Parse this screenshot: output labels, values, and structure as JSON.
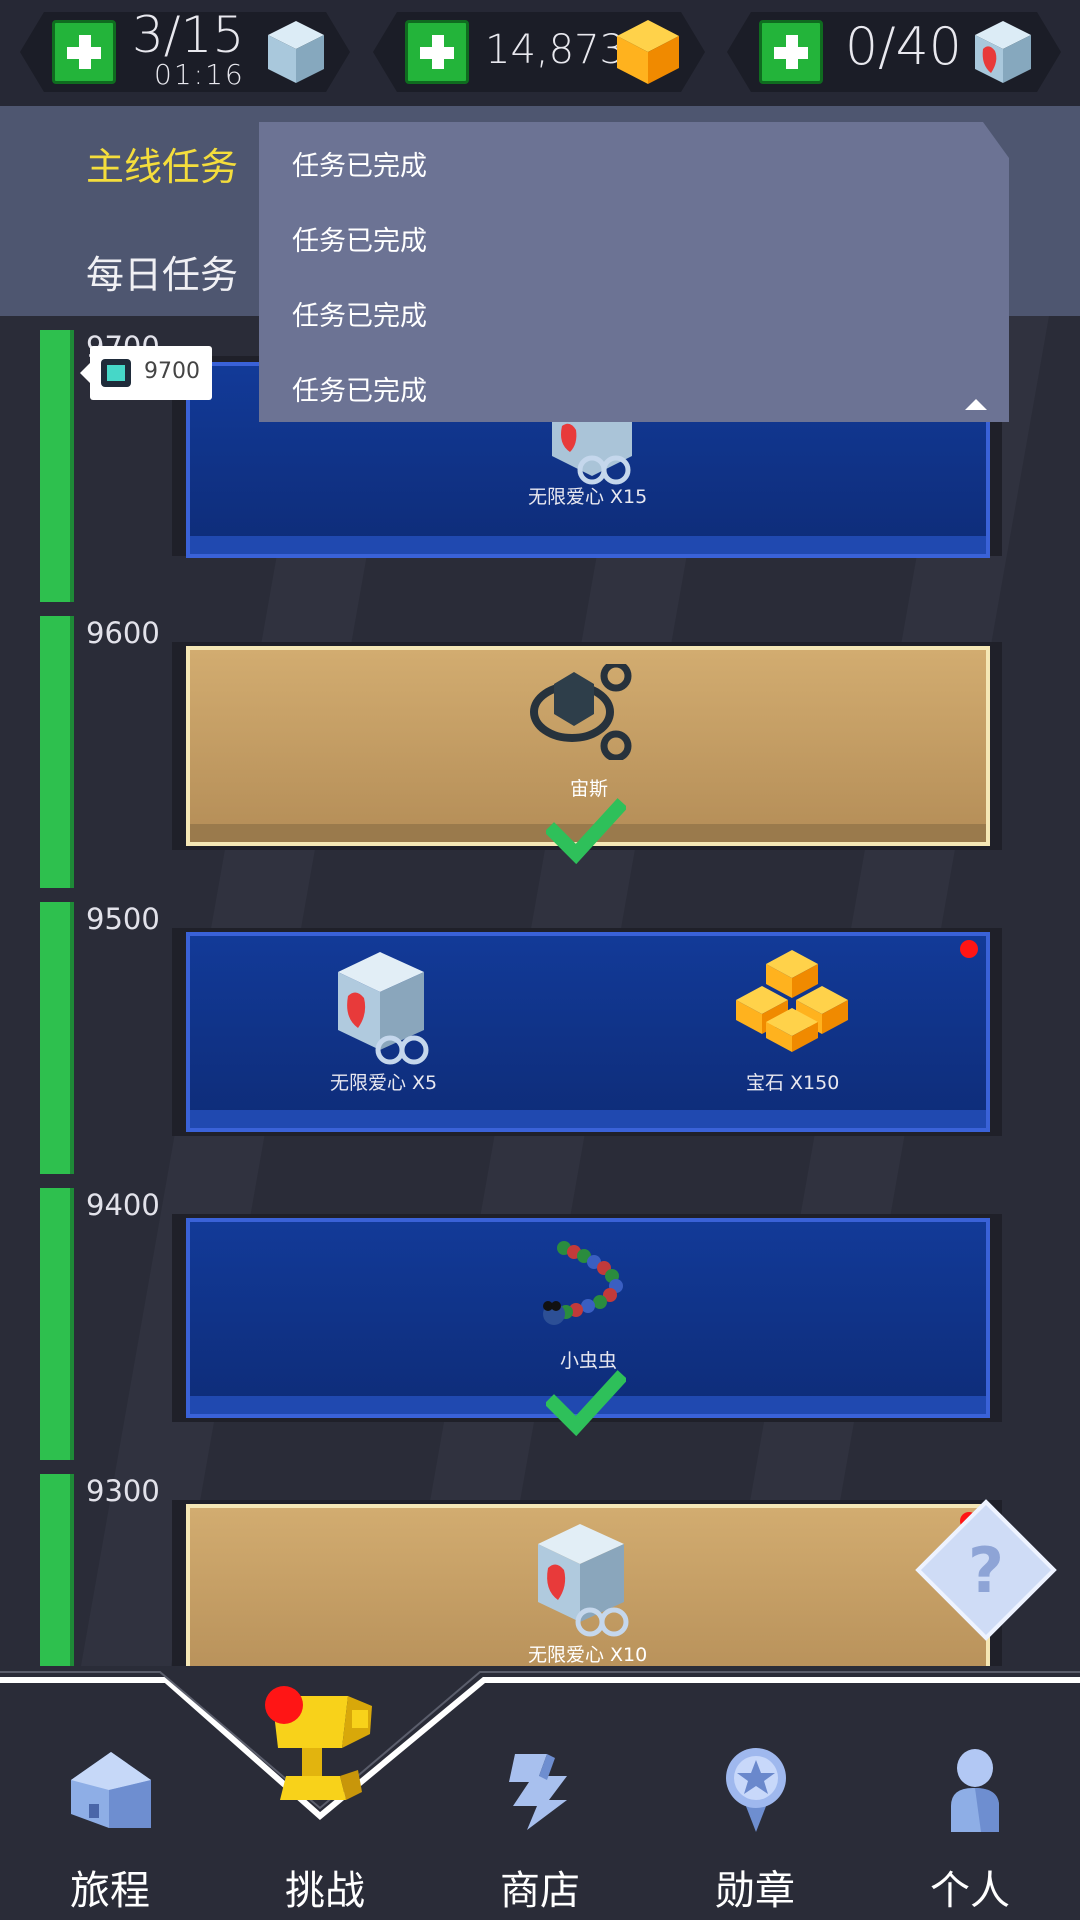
{
  "resources": {
    "energy": {
      "value": "3/15",
      "timer": "01:16",
      "icon": "cube-icon"
    },
    "gems": {
      "value": "14,873",
      "icon": "gem-icon"
    },
    "hearts": {
      "value": "0/40",
      "icon": "heart-cube-icon"
    }
  },
  "tabs": {
    "main": "主线任务",
    "daily": "每日任务",
    "active": "main"
  },
  "dropdown": {
    "items": [
      "任务已完成",
      "任务已完成",
      "任务已完成",
      "任务已完成"
    ]
  },
  "progress_callout": {
    "value": "9700"
  },
  "levels": [
    {
      "score": "9700",
      "style": "blue",
      "rewards": [
        "无限爱心 X15"
      ],
      "claimed": false
    },
    {
      "score": "9600",
      "style": "gold",
      "rewards": [
        "宙斯"
      ],
      "claimed": true
    },
    {
      "score": "9500",
      "style": "blue",
      "rewards": [
        "无限爱心 X5",
        "宝石 X150"
      ],
      "claimed": false,
      "notify": true
    },
    {
      "score": "9400",
      "style": "blue",
      "rewards": [
        "小虫虫"
      ],
      "claimed": true
    },
    {
      "score": "9300",
      "style": "gold",
      "rewards": [
        "无限爱心 X10"
      ],
      "claimed": false,
      "notify": true
    }
  ],
  "nav": [
    {
      "label": "旅程",
      "icon": "house-icon"
    },
    {
      "label": "挑战",
      "icon": "trophy-icon",
      "active": true,
      "notify": true
    },
    {
      "label": "商店",
      "icon": "shop-icon"
    },
    {
      "label": "勋章",
      "icon": "medal-icon"
    },
    {
      "label": "个人",
      "icon": "person-icon"
    }
  ],
  "colors": {
    "background": "#2a2c38",
    "tab_active": "#f4dd3c",
    "dropdown": "#6c7394",
    "progress": "#2ec04e",
    "card_blue": "#123a98",
    "card_gold": "#d2ac70",
    "notify": "#ff1515"
  }
}
